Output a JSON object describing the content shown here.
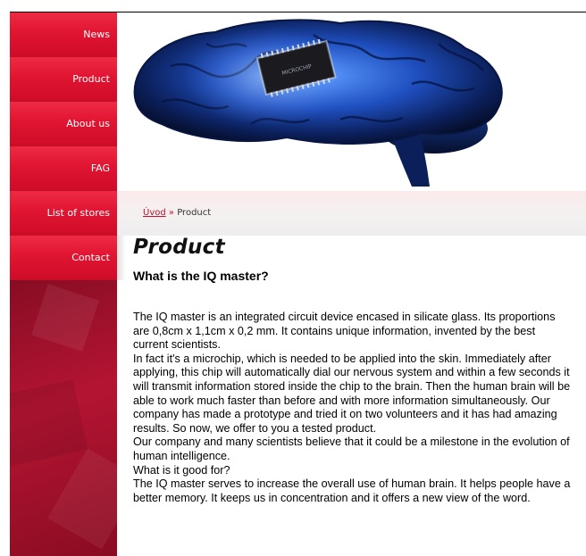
{
  "nav": {
    "items": [
      {
        "label": "News"
      },
      {
        "label": "Product"
      },
      {
        "label": "About us"
      },
      {
        "label": "FAG"
      },
      {
        "label": "List of stores"
      },
      {
        "label": "Contact"
      }
    ]
  },
  "header": {
    "image_alt": "brain with microchip",
    "chip_text": "MICROCHIP"
  },
  "breadcrumb": {
    "home": "Úvod",
    "separator": "»",
    "current": "Product"
  },
  "page": {
    "title": "Product",
    "subtitle": "What is the IQ master?",
    "paragraphs": [
      "The IQ master is an integrated circuit device encased in silicate glass. Its proportions are 0,8cm x 1,1cm x 0,2 mm. It contains unique information, invented by the best current scientists.",
      "In fact it's a microchip, which is needed to be applied into the skin. Immediately after applying, this chip will automatically dial our nervous system and within a few seconds it will transmit information stored inside the chip to the brain. Then the human brain will be able to work much faster than before and with more information simultaneously. Our company has made a prototype and tried it on two volunteers and it has had amazing results. So now, we offer to you a tested product.",
      "Our company and many scientists believe that it could be a milestone in the evolution of human intelligence.",
      "What is it good for?",
      "The IQ master serves to increase the overall use of human brain. It helps people have a better memory. It keeps us in concentration and it offers a new view of the word."
    ]
  },
  "colors": {
    "nav_red": "#e01532",
    "sidebar_dark": "#8a0c22",
    "link_red": "#c8102e",
    "brain_blue": "#2f6fe0"
  }
}
